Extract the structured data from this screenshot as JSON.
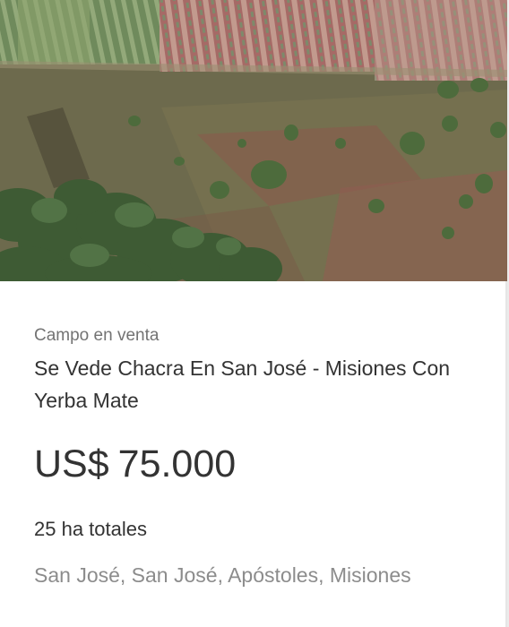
{
  "listing": {
    "category": "Campo en venta",
    "title": "Se Vede Chacra En San José - Misiones Con Yerba Mate",
    "price": {
      "currency": "US$",
      "amount": "75.000"
    },
    "area": "25 ha totales",
    "location": "San José, San José, Apóstoles, Misiones"
  },
  "colors": {
    "text_primary": "#333333",
    "text_secondary": "#737373",
    "text_location": "#8c8c8c",
    "card_background": "#ffffff"
  }
}
